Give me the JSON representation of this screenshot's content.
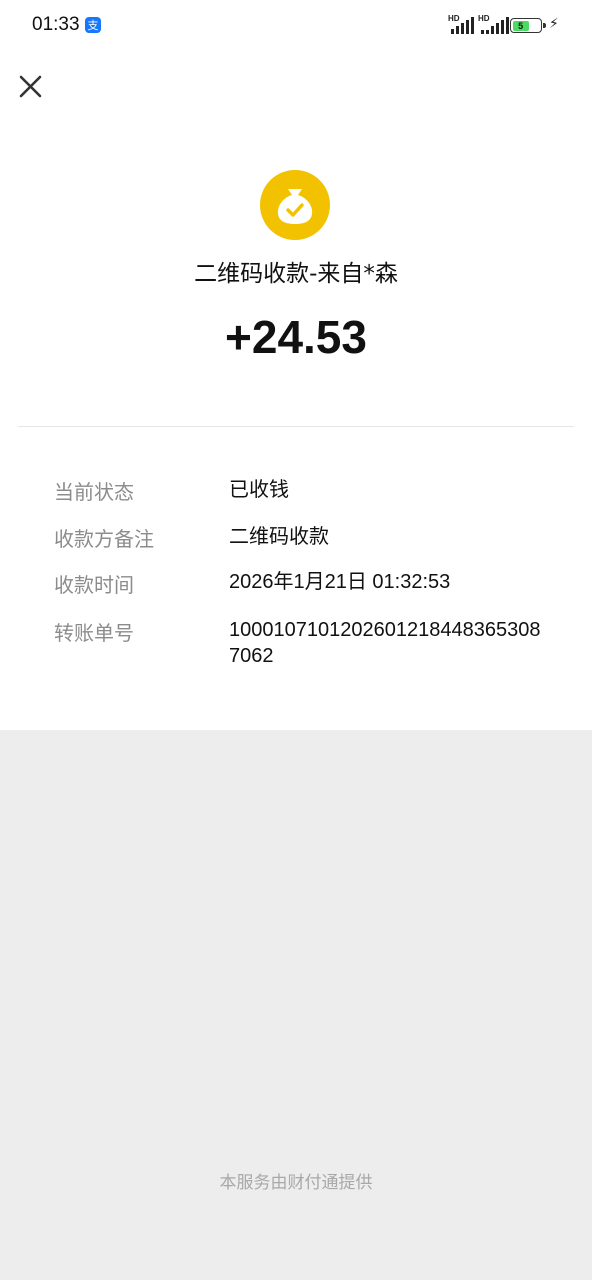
{
  "status_bar": {
    "time": "01:33",
    "app_badge": "支",
    "signal_1_label": "HD",
    "signal_2_label": "HD",
    "battery_level": "5",
    "battery_fraction": 0.05
  },
  "nav": {
    "close_icon": "close-icon"
  },
  "transaction": {
    "icon": "money-bag-check-icon",
    "icon_color": "#f2c200",
    "title": "二维码收款-来自*森",
    "amount": "+24.53"
  },
  "details": [
    {
      "label": "当前状态",
      "value": "已收钱"
    },
    {
      "label": "收款方备注",
      "value": "二维码收款"
    },
    {
      "label": "收款时间",
      "value": "2026年1月21日 01:32:53"
    },
    {
      "label": "转账单号",
      "value": "10001071012026012184483653087062"
    }
  ],
  "footer": {
    "text": "本服务由财付通提供"
  }
}
